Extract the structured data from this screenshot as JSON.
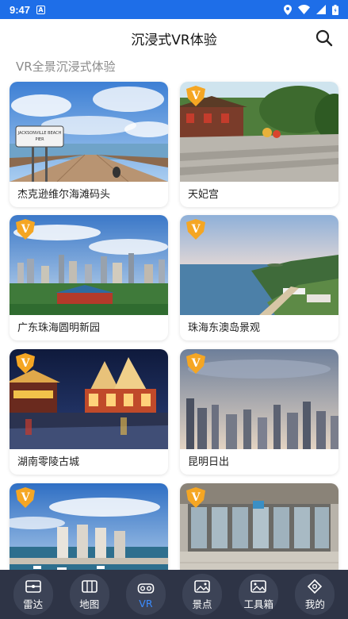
{
  "status_bar": {
    "time": "9:47",
    "sim_letter": "A"
  },
  "header": {
    "title": "沉浸式VR体验"
  },
  "section": {
    "title": "VR全景沉浸式体验"
  },
  "cards": [
    {
      "name": "杰克逊维尔海滩码头",
      "sign_lines": [
        "JACKSONVILLE BEACH",
        "PIER"
      ]
    },
    {
      "name": "天妃宫"
    },
    {
      "name": "广东珠海圆明新园"
    },
    {
      "name": "珠海东澳岛景观"
    },
    {
      "name": "湖南零陵古城"
    },
    {
      "name": "昆明日出"
    },
    {
      "name": ""
    },
    {
      "name": ""
    }
  ],
  "tabbar": {
    "items": [
      {
        "label": "雷达",
        "icon": "radar-icon",
        "active": false
      },
      {
        "label": "地图",
        "icon": "map-icon",
        "active": false
      },
      {
        "label": "VR",
        "icon": "vr-goggles-icon",
        "active": true
      },
      {
        "label": "景点",
        "icon": "scenic-spot-icon",
        "active": false
      },
      {
        "label": "工具箱",
        "icon": "toolbox-icon",
        "active": false
      },
      {
        "label": "我的",
        "icon": "profile-icon",
        "active": false
      }
    ]
  },
  "colors": {
    "status_bar": "#1e6ee8",
    "tabbar": "#2e3446",
    "active_tab": "#3b8cff",
    "badge": "#f5a623"
  }
}
